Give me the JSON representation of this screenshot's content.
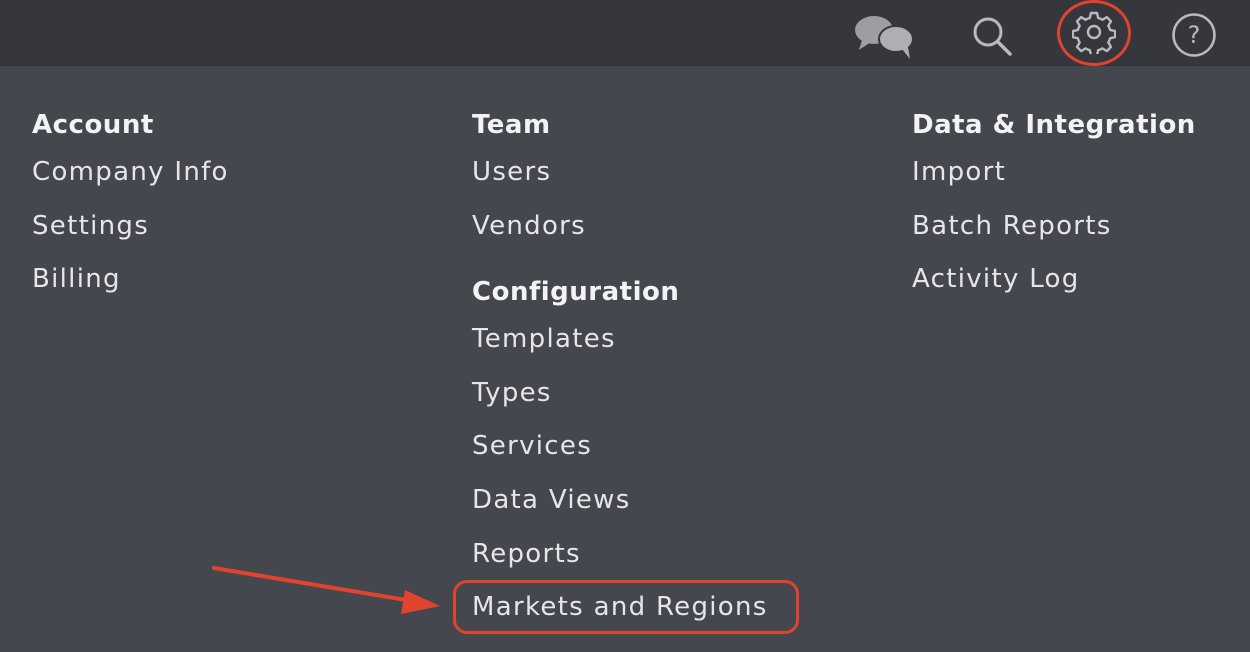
{
  "topbar": {
    "icons": [
      "chat-icon",
      "search-icon",
      "gear-icon",
      "help-icon"
    ],
    "help_glyph": "?"
  },
  "menu": {
    "account": {
      "heading": "Account",
      "items": [
        "Company Info",
        "Settings",
        "Billing"
      ]
    },
    "team": {
      "heading": "Team",
      "items": [
        "Users",
        "Vendors"
      ]
    },
    "configuration": {
      "heading": "Configuration",
      "items": [
        "Templates",
        "Types",
        "Services",
        "Data Views",
        "Reports",
        "Markets and Regions"
      ]
    },
    "data_integration": {
      "heading": "Data & Integration",
      "items": [
        "Import",
        "Batch Reports",
        "Activity Log"
      ]
    }
  },
  "colors": {
    "background": "#45474e",
    "topbar": "#36373d",
    "annotation": "#e0442e",
    "text": "#e6e6ea",
    "icon": "#b9bac0"
  }
}
